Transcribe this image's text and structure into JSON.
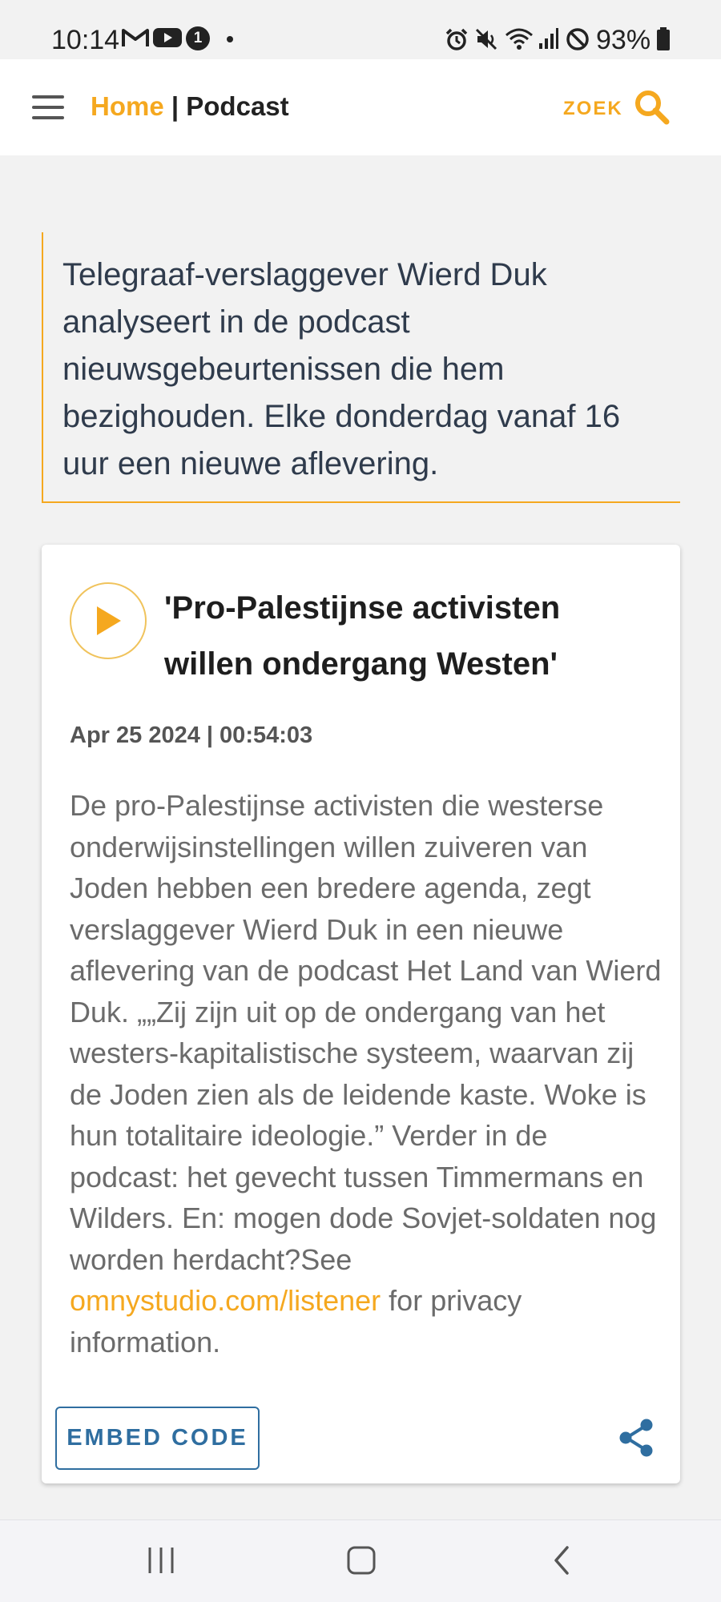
{
  "status_bar": {
    "time": "10:14",
    "notification_count": "1",
    "battery": "93%",
    "icons": [
      "gmail-icon",
      "youtube-icon",
      "notification-badge-icon",
      "dot-icon",
      "alarm-icon",
      "mute-icon",
      "wifi-icon",
      "signal-icon",
      "dnd-icon",
      "battery-icon"
    ]
  },
  "app_bar": {
    "home_label": "Home",
    "separator": " | ",
    "page_label": "Podcast",
    "search_label": "ZOEK"
  },
  "intro": {
    "text": "Telegraaf-verslaggever Wierd Duk analyseert in de podcast nieuwsgebeurtenissen die hem bezighouden. Elke donderdag vanaf 16 uur een nieuwe aflevering."
  },
  "episode": {
    "title": "'Pro-Palestijnse activisten willen ondergang Westen'",
    "meta": "Apr 25 2024 | 00:54:03",
    "description": "De pro-Palestijnse activisten die westerse onderwijsinstellingen willen zuiveren van Joden hebben een bredere agenda, zegt verslaggever Wierd Duk in een nieuwe aflevering van de podcast Het Land van Wierd Duk. „„Zij zijn uit op de ondergang van het westers-kapitalistische systeem, waarvan zij de Joden zien als de leidende kaste. Woke is hun totalitaire ideologie.” Verder in de podcast: het gevecht tussen Timmermans en Wilders. En: mogen dode Sovjet-soldaten nog worden herdacht?See ",
    "link_text": "omnystudio.com/listener",
    "description_suffix": " for privacy information.",
    "embed_label": "EMBED CODE"
  },
  "colors": {
    "accent": "#f5a81f",
    "link_blue": "#2f6ea0",
    "text_dark": "#2f3b4c"
  }
}
